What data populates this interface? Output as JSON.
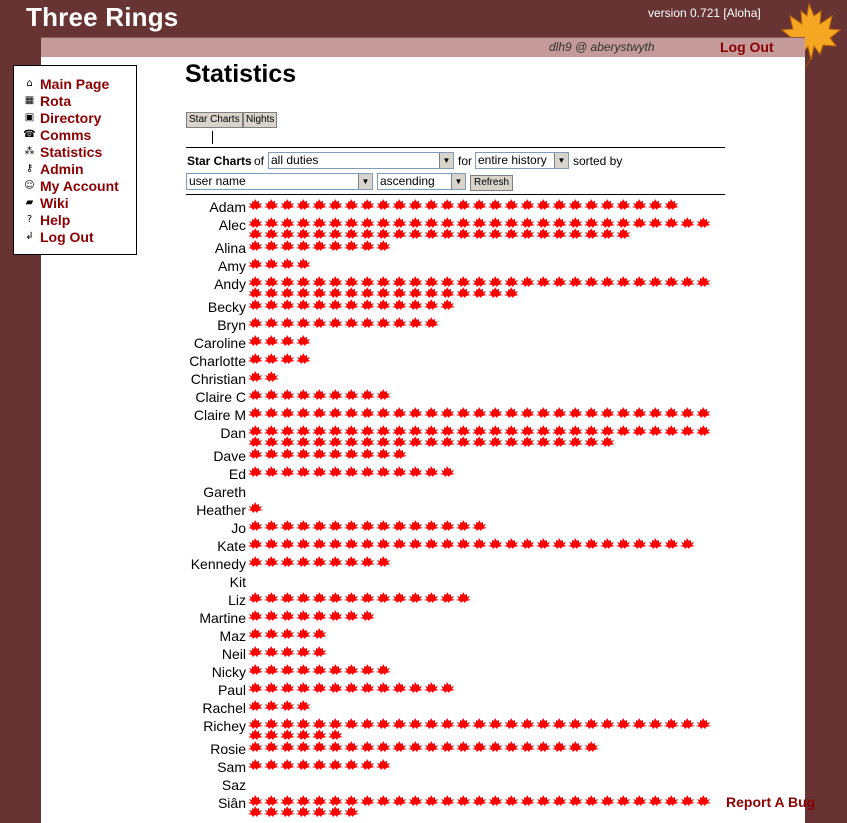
{
  "header": {
    "app_title": "Three Rings",
    "version": "version 0.721 [Aloha]",
    "user": "dlh9 @ aberystwyth",
    "logout": "Log Out"
  },
  "menu": [
    {
      "label": "Main Page",
      "icon": "house-icon",
      "glyph": "⌂"
    },
    {
      "label": "Rota",
      "icon": "grid-icon",
      "glyph": "▦"
    },
    {
      "label": "Directory",
      "icon": "directory-icon",
      "glyph": "▣"
    },
    {
      "label": "Comms",
      "icon": "telephone-icon",
      "glyph": "☎"
    },
    {
      "label": "Statistics",
      "icon": "statistics-icon",
      "glyph": "⁂"
    },
    {
      "label": "Admin",
      "icon": "key-icon",
      "glyph": "⚷"
    },
    {
      "label": "My Account",
      "icon": "smiley-icon",
      "glyph": "☺"
    },
    {
      "label": "Wiki",
      "icon": "wiki-icon",
      "glyph": "▰"
    },
    {
      "label": "Help",
      "icon": "help-icon",
      "glyph": "?"
    },
    {
      "label": "Log Out",
      "icon": "logout-arrow-icon",
      "glyph": "↲"
    }
  ],
  "page": {
    "title": "Statistics",
    "tabs": [
      "Star Charts",
      "Nights"
    ]
  },
  "controls": {
    "label_star_charts": "Star Charts",
    "label_of": "of",
    "duty_select": "all duties",
    "label_for": "for",
    "period_select": "entire history",
    "label_sorted_by": "sorted by",
    "sort_select": "user name",
    "order_select": "ascending",
    "refresh": "Refresh"
  },
  "colors": {
    "background": "#673333",
    "star": "#ff0000",
    "link": "#8b0000",
    "userbar": "#c49a9a"
  },
  "stars": [
    {
      "name": "Adam",
      "count": 27
    },
    {
      "name": "Alec",
      "count": 53
    },
    {
      "name": "Alina",
      "count": 9
    },
    {
      "name": "Amy",
      "count": 4
    },
    {
      "name": "Andy",
      "count": 46
    },
    {
      "name": "Becky",
      "count": 13
    },
    {
      "name": "Bryn",
      "count": 12
    },
    {
      "name": "Caroline",
      "count": 4
    },
    {
      "name": "Charlotte",
      "count": 4
    },
    {
      "name": "Christian",
      "count": 2
    },
    {
      "name": "Claire C",
      "count": 9
    },
    {
      "name": "Claire M",
      "count": 29
    },
    {
      "name": "Dan",
      "count": 52
    },
    {
      "name": "Dave",
      "count": 10
    },
    {
      "name": "Ed",
      "count": 13
    },
    {
      "name": "Gareth",
      "count": 0
    },
    {
      "name": "Heather",
      "count": 1
    },
    {
      "name": "Jo",
      "count": 15
    },
    {
      "name": "Kate",
      "count": 28
    },
    {
      "name": "Kennedy",
      "count": 9
    },
    {
      "name": "Kit",
      "count": 0
    },
    {
      "name": "Liz",
      "count": 14
    },
    {
      "name": "Martine",
      "count": 8
    },
    {
      "name": "Maz",
      "count": 5
    },
    {
      "name": "Neil",
      "count": 5
    },
    {
      "name": "Nicky",
      "count": 9
    },
    {
      "name": "Paul",
      "count": 13
    },
    {
      "name": "Rachel",
      "count": 4
    },
    {
      "name": "Richey",
      "count": 35
    },
    {
      "name": "Rosie",
      "count": 22
    },
    {
      "name": "Sam",
      "count": 9
    },
    {
      "name": "Saz",
      "count": 0
    },
    {
      "name": "Siân",
      "count": 36
    }
  ],
  "footer": {
    "report_bug": "Report A Bug"
  }
}
